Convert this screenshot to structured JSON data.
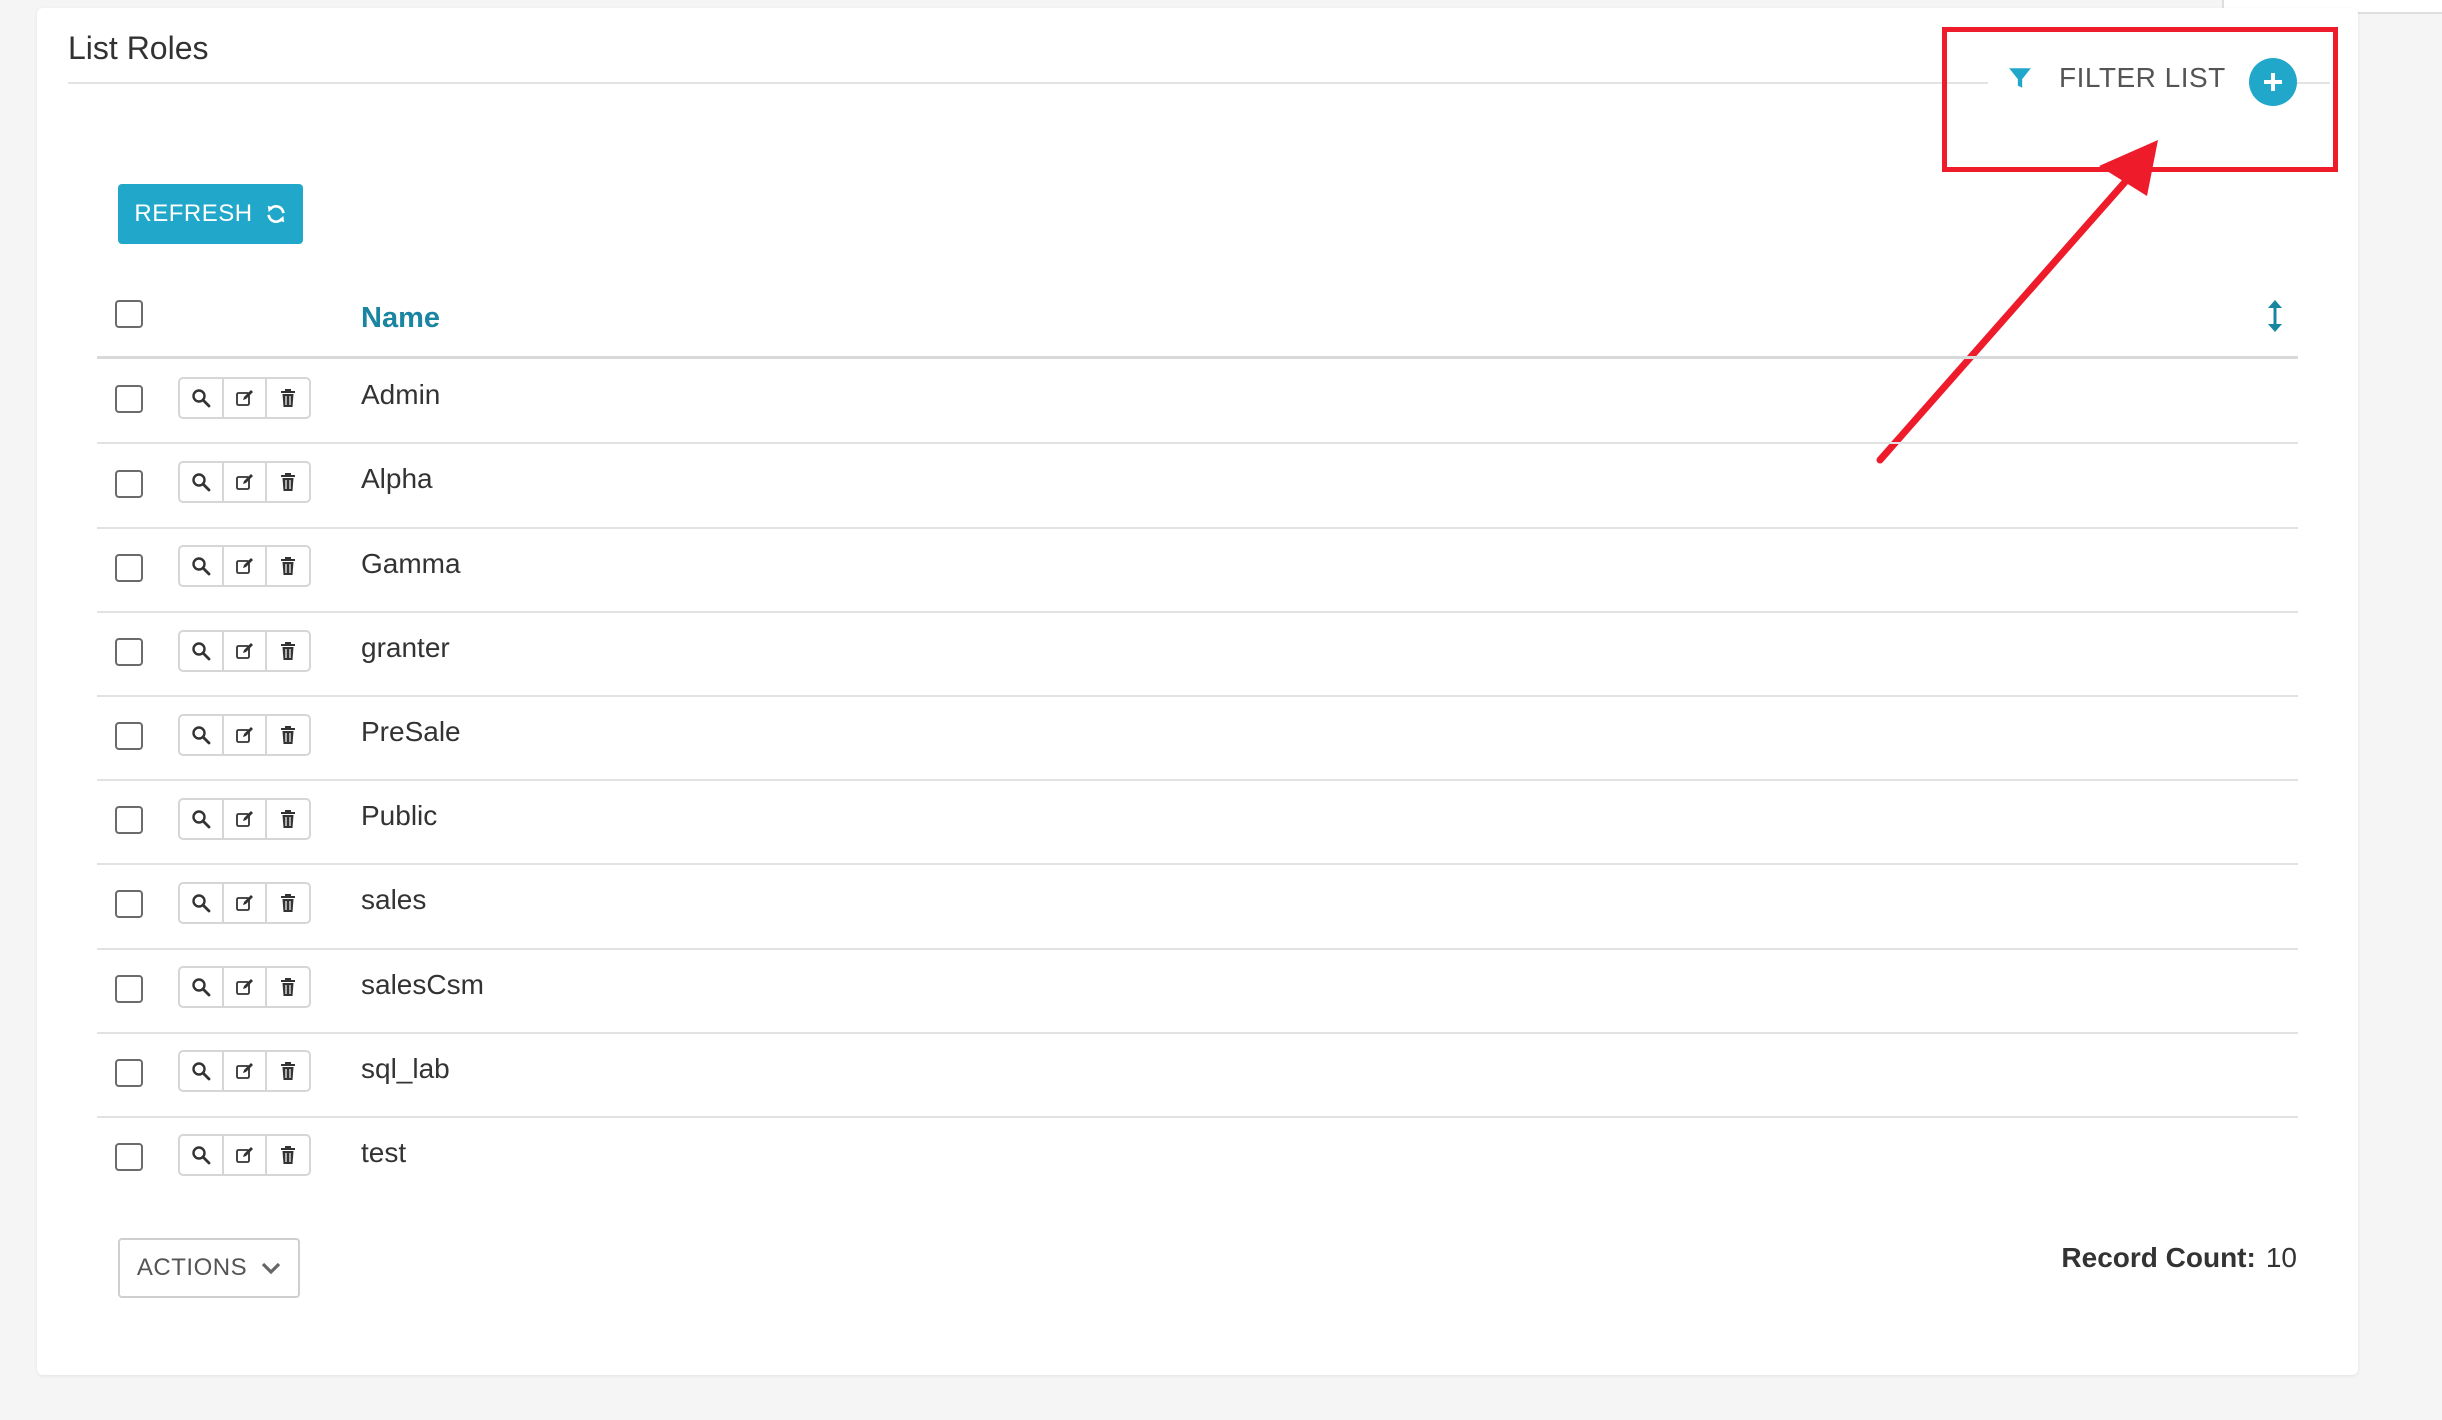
{
  "page": {
    "title": "List Roles",
    "filter_label": "FILTER LIST",
    "refresh_label": "REFRESH",
    "actions_label": "ACTIONS",
    "record_count_label": "Record Count:",
    "record_count_value": "10"
  },
  "table": {
    "columns": [
      "Name"
    ],
    "rows": [
      {
        "name": "Admin"
      },
      {
        "name": "Alpha"
      },
      {
        "name": "Gamma"
      },
      {
        "name": "granter"
      },
      {
        "name": "PreSale"
      },
      {
        "name": "Public"
      },
      {
        "name": "sales"
      },
      {
        "name": "salesCsm"
      },
      {
        "name": "sql_lab"
      },
      {
        "name": "test"
      }
    ]
  },
  "icons": {
    "filter": "filter-funnel-icon",
    "add": "plus-circle-icon",
    "refresh": "refresh-icon",
    "sort": "sort-vertical-icon",
    "view": "search-icon",
    "edit": "edit-icon",
    "delete": "trash-icon",
    "dropdown": "chevron-down-icon"
  },
  "colors": {
    "accent": "#20a7c9",
    "header_text": "#1a85a0",
    "annotation": "#ee1c2b"
  }
}
